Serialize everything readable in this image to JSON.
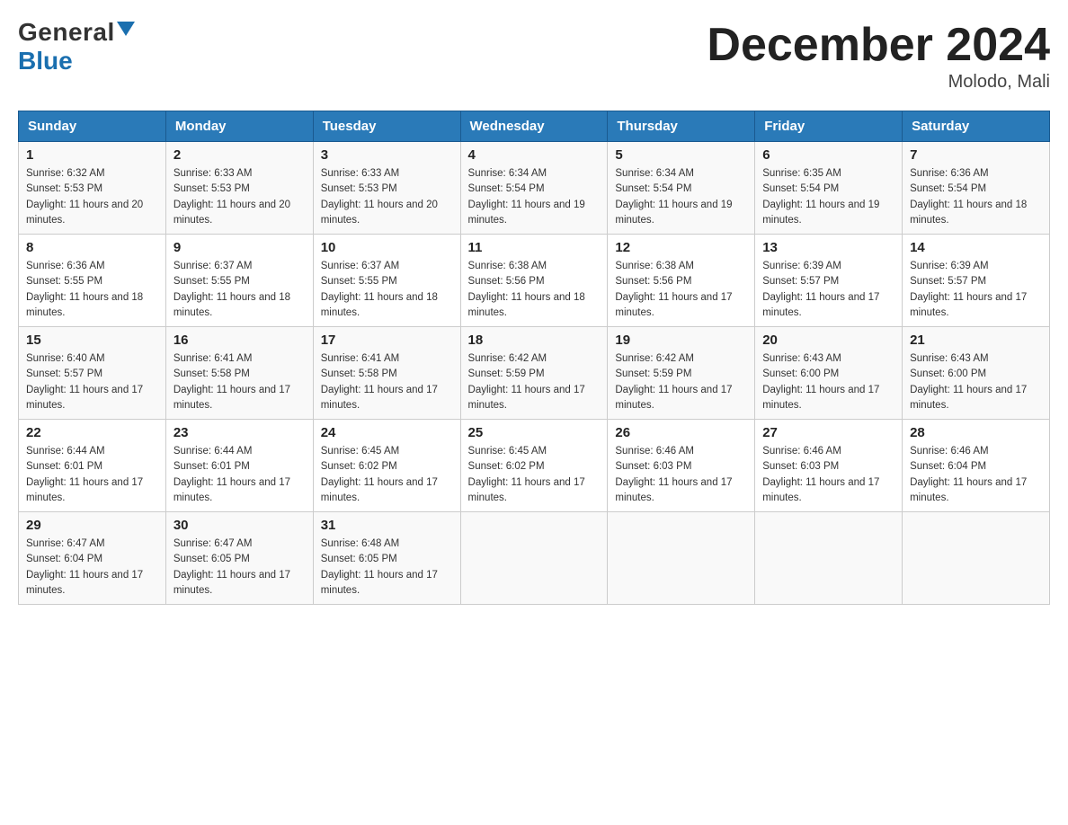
{
  "header": {
    "logo_general": "General",
    "logo_blue": "Blue",
    "title": "December 2024",
    "location": "Molodo, Mali"
  },
  "calendar": {
    "days_of_week": [
      "Sunday",
      "Monday",
      "Tuesday",
      "Wednesday",
      "Thursday",
      "Friday",
      "Saturday"
    ],
    "weeks": [
      [
        {
          "day": 1,
          "sunrise": "6:32 AM",
          "sunset": "5:53 PM",
          "daylight": "11 hours and 20 minutes."
        },
        {
          "day": 2,
          "sunrise": "6:33 AM",
          "sunset": "5:53 PM",
          "daylight": "11 hours and 20 minutes."
        },
        {
          "day": 3,
          "sunrise": "6:33 AM",
          "sunset": "5:53 PM",
          "daylight": "11 hours and 20 minutes."
        },
        {
          "day": 4,
          "sunrise": "6:34 AM",
          "sunset": "5:54 PM",
          "daylight": "11 hours and 19 minutes."
        },
        {
          "day": 5,
          "sunrise": "6:34 AM",
          "sunset": "5:54 PM",
          "daylight": "11 hours and 19 minutes."
        },
        {
          "day": 6,
          "sunrise": "6:35 AM",
          "sunset": "5:54 PM",
          "daylight": "11 hours and 19 minutes."
        },
        {
          "day": 7,
          "sunrise": "6:36 AM",
          "sunset": "5:54 PM",
          "daylight": "11 hours and 18 minutes."
        }
      ],
      [
        {
          "day": 8,
          "sunrise": "6:36 AM",
          "sunset": "5:55 PM",
          "daylight": "11 hours and 18 minutes."
        },
        {
          "day": 9,
          "sunrise": "6:37 AM",
          "sunset": "5:55 PM",
          "daylight": "11 hours and 18 minutes."
        },
        {
          "day": 10,
          "sunrise": "6:37 AM",
          "sunset": "5:55 PM",
          "daylight": "11 hours and 18 minutes."
        },
        {
          "day": 11,
          "sunrise": "6:38 AM",
          "sunset": "5:56 PM",
          "daylight": "11 hours and 18 minutes."
        },
        {
          "day": 12,
          "sunrise": "6:38 AM",
          "sunset": "5:56 PM",
          "daylight": "11 hours and 17 minutes."
        },
        {
          "day": 13,
          "sunrise": "6:39 AM",
          "sunset": "5:57 PM",
          "daylight": "11 hours and 17 minutes."
        },
        {
          "day": 14,
          "sunrise": "6:39 AM",
          "sunset": "5:57 PM",
          "daylight": "11 hours and 17 minutes."
        }
      ],
      [
        {
          "day": 15,
          "sunrise": "6:40 AM",
          "sunset": "5:57 PM",
          "daylight": "11 hours and 17 minutes."
        },
        {
          "day": 16,
          "sunrise": "6:41 AM",
          "sunset": "5:58 PM",
          "daylight": "11 hours and 17 minutes."
        },
        {
          "day": 17,
          "sunrise": "6:41 AM",
          "sunset": "5:58 PM",
          "daylight": "11 hours and 17 minutes."
        },
        {
          "day": 18,
          "sunrise": "6:42 AM",
          "sunset": "5:59 PM",
          "daylight": "11 hours and 17 minutes."
        },
        {
          "day": 19,
          "sunrise": "6:42 AM",
          "sunset": "5:59 PM",
          "daylight": "11 hours and 17 minutes."
        },
        {
          "day": 20,
          "sunrise": "6:43 AM",
          "sunset": "6:00 PM",
          "daylight": "11 hours and 17 minutes."
        },
        {
          "day": 21,
          "sunrise": "6:43 AM",
          "sunset": "6:00 PM",
          "daylight": "11 hours and 17 minutes."
        }
      ],
      [
        {
          "day": 22,
          "sunrise": "6:44 AM",
          "sunset": "6:01 PM",
          "daylight": "11 hours and 17 minutes."
        },
        {
          "day": 23,
          "sunrise": "6:44 AM",
          "sunset": "6:01 PM",
          "daylight": "11 hours and 17 minutes."
        },
        {
          "day": 24,
          "sunrise": "6:45 AM",
          "sunset": "6:02 PM",
          "daylight": "11 hours and 17 minutes."
        },
        {
          "day": 25,
          "sunrise": "6:45 AM",
          "sunset": "6:02 PM",
          "daylight": "11 hours and 17 minutes."
        },
        {
          "day": 26,
          "sunrise": "6:46 AM",
          "sunset": "6:03 PM",
          "daylight": "11 hours and 17 minutes."
        },
        {
          "day": 27,
          "sunrise": "6:46 AM",
          "sunset": "6:03 PM",
          "daylight": "11 hours and 17 minutes."
        },
        {
          "day": 28,
          "sunrise": "6:46 AM",
          "sunset": "6:04 PM",
          "daylight": "11 hours and 17 minutes."
        }
      ],
      [
        {
          "day": 29,
          "sunrise": "6:47 AM",
          "sunset": "6:04 PM",
          "daylight": "11 hours and 17 minutes."
        },
        {
          "day": 30,
          "sunrise": "6:47 AM",
          "sunset": "6:05 PM",
          "daylight": "11 hours and 17 minutes."
        },
        {
          "day": 31,
          "sunrise": "6:48 AM",
          "sunset": "6:05 PM",
          "daylight": "11 hours and 17 minutes."
        },
        null,
        null,
        null,
        null
      ]
    ]
  }
}
